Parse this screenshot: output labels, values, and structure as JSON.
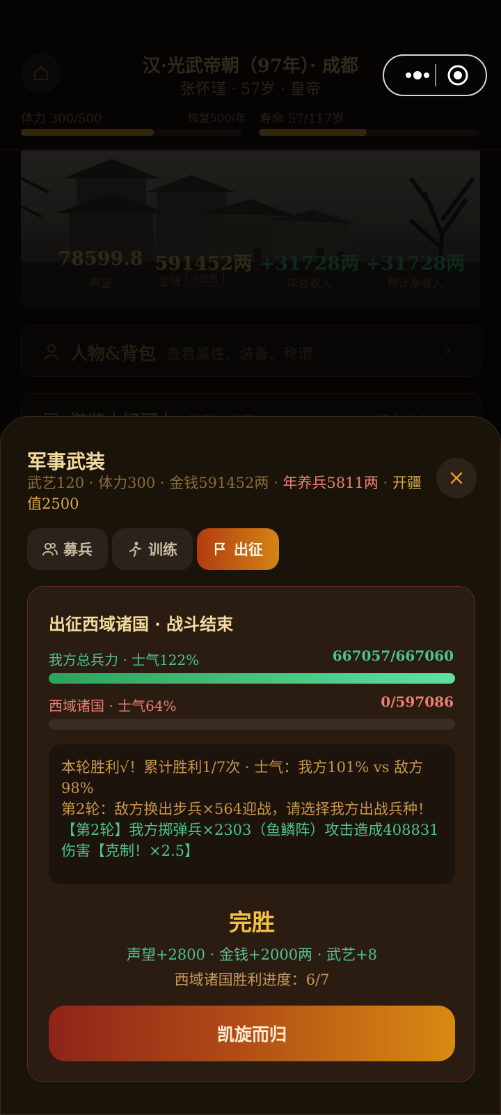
{
  "header": {
    "title": "汉·光武帝朝（97年）· 成都",
    "subtitle": "张怀瑾 · 57岁 · 皇帝"
  },
  "stats": {
    "stamina_label": "体力 300/500",
    "stamina_recover": "恢复500/年",
    "stamina_fraction": 0.6,
    "lifespan_label": "寿命 57/117岁",
    "lifespan_fraction": 0.487
  },
  "summary": [
    {
      "value": "78599.8",
      "label": "声望",
      "color": "#6b5a32"
    },
    {
      "value": "591452两",
      "label": "金钱",
      "badge": "+银两",
      "color": "#6b5a32"
    },
    {
      "value": "+31728两",
      "label": "年总收入",
      "color": "#1f5a3b"
    },
    {
      "value": "+31728两",
      "label": "预计净收入",
      "color": "#1f5a3b"
    }
  ],
  "menu": [
    {
      "title": "人物&背包",
      "desc": "查看属性、装备、称谓",
      "icon": "person-icon"
    },
    {
      "title": "游览大好河山",
      "desc": "游历 · 成都",
      "extra": "打卡城市",
      "icon": "map-icon"
    }
  ],
  "sheet": {
    "title": "军事武装",
    "subtitle_plain": "武艺120 · 体力300 · 金钱591452两 · ",
    "subtitle_upkeep": "年养兵5811两",
    "subtitle_sep": " · ",
    "subtitle_frontier": "开疆值2500",
    "tabs": [
      {
        "label": "募兵",
        "icon": "recruit-icon",
        "active": false
      },
      {
        "label": "训练",
        "icon": "running-icon",
        "active": false
      },
      {
        "label": "出征",
        "icon": "flag-icon",
        "active": true
      }
    ]
  },
  "battle": {
    "title": "出征西域诸国 · 战斗结束",
    "our_label": "我方总兵力 · 士气122%",
    "our_value": "667057/667060",
    "our_fraction": 0.999995,
    "enemy_label": "西域诸国 · 士气64%",
    "enemy_value": "0/597086",
    "enemy_fraction": 0,
    "log": [
      "本轮胜利√！累计胜利1/7次 · 士气：我方101% vs 敌方98%",
      "第2轮：敌方换出步兵×564迎战，请选择我方出战兵种！",
      "【第2轮】我方掷弹兵×2303（鱼鳞阵）攻击造成408831伤害【克制！×2.5】"
    ],
    "result": "完胜",
    "reward": "声望+2800 · 金钱+2000两 · 武艺+8",
    "progress": "西域诸国胜利进度：6/7",
    "return_button": "凯旋而归"
  },
  "colors": {
    "accent_gold": "#f4bf48",
    "accent_green": "#4fc38a",
    "accent_red": "#e98073",
    "sheet_bg": "#191309"
  }
}
